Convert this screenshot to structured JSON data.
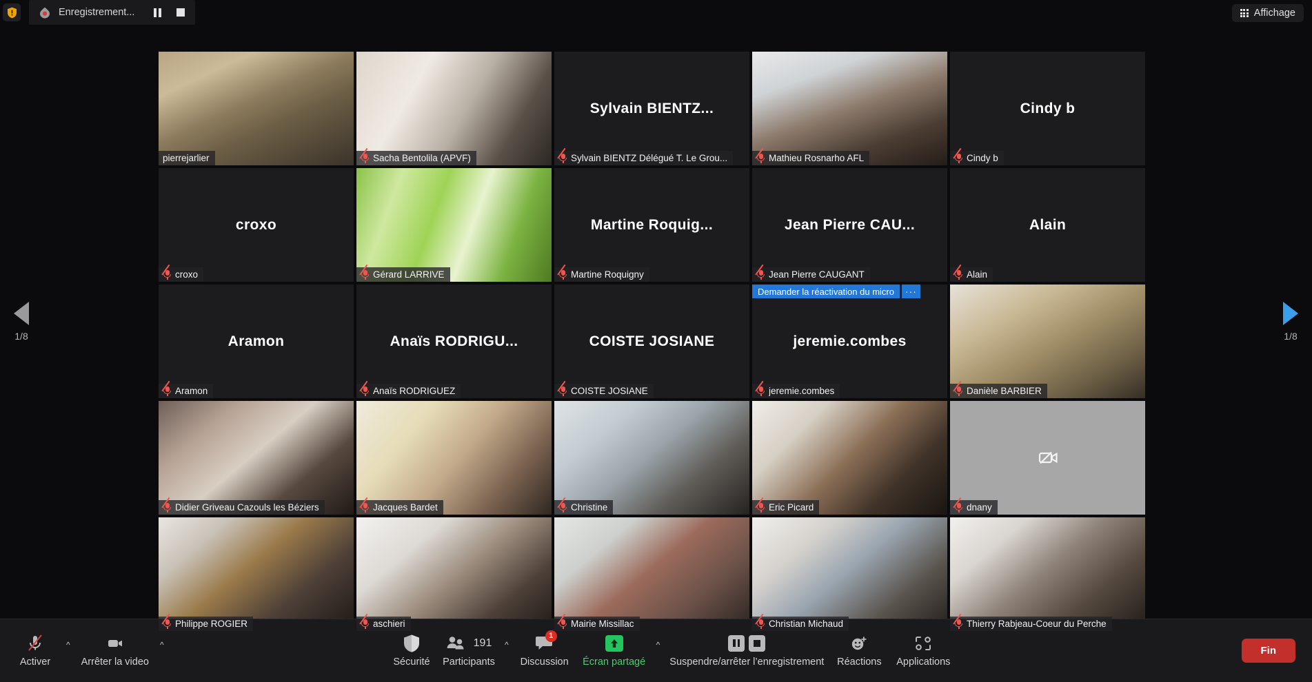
{
  "topbar": {
    "shield_icon": "security-shield-icon",
    "recording_icon": "recording-dot-icon",
    "recording_label": "Enregistrement...",
    "pause_recording_icon": "pause-icon",
    "stop_recording_icon": "stop-icon",
    "view_button_label": "Affichage",
    "view_button_icon": "grid-view-icon"
  },
  "gallery": {
    "prev_page_icon": "chevron-left-icon",
    "next_page_icon": "chevron-right-icon",
    "prev_page_indicator": "1/8",
    "next_page_indicator": "1/8",
    "muted_icon": "microphone-muted-icon",
    "no_video_icon": "camera-off-icon",
    "hover_controls": {
      "request_unmute_label": "Demander la réactivation du micro",
      "more_label": "···"
    },
    "tiles": [
      {
        "name": "pierrejarlier",
        "display": "",
        "video": true,
        "muted": false,
        "active": true,
        "bg": "bookshelf"
      },
      {
        "name": "Sacha Bentolila (APVF)",
        "display": "",
        "video": true,
        "muted": true,
        "active": false,
        "bg": "whiteroom"
      },
      {
        "name": "Sylvain BIENTZ Délégué T. Le Grou...",
        "display": "Sylvain  BIENTZ...",
        "video": false,
        "muted": true,
        "active": false,
        "bg": ""
      },
      {
        "name": "Mathieu Rosnarho AFL",
        "display": "",
        "video": true,
        "muted": true,
        "active": false,
        "bg": "manwindow"
      },
      {
        "name": "Cindy b",
        "display": "Cindy b",
        "video": false,
        "muted": true,
        "active": false,
        "bg": ""
      },
      {
        "name": "croxo",
        "display": "croxo",
        "video": false,
        "muted": true,
        "active": false,
        "bg": ""
      },
      {
        "name": "Gérard LARRIVE",
        "display": "",
        "video": true,
        "muted": true,
        "active": false,
        "bg": "grass"
      },
      {
        "name": "Martine Roquigny",
        "display": "Martine  Roquig...",
        "video": false,
        "muted": true,
        "active": false,
        "bg": ""
      },
      {
        "name": "Jean Pierre CAUGANT",
        "display": "Jean Pierre CAU...",
        "video": false,
        "muted": true,
        "active": false,
        "bg": ""
      },
      {
        "name": "Alain",
        "display": "Alain",
        "video": false,
        "muted": true,
        "active": false,
        "bg": ""
      },
      {
        "name": "Aramon",
        "display": "Aramon",
        "video": false,
        "muted": true,
        "active": false,
        "bg": ""
      },
      {
        "name": "Anaïs RODRIGUEZ",
        "display": "Anaïs  RODRIGU...",
        "video": false,
        "muted": true,
        "active": false,
        "bg": ""
      },
      {
        "name": "COISTE JOSIANE",
        "display": "COISTE JOSIANE",
        "video": false,
        "muted": true,
        "active": false,
        "bg": ""
      },
      {
        "name": "jeremie.combes",
        "display": "jeremie.combes",
        "video": false,
        "muted": true,
        "active": false,
        "bg": "",
        "hovered": true
      },
      {
        "name": "Danièle BARBIER",
        "display": "",
        "video": true,
        "muted": true,
        "active": false,
        "bg": "shelves"
      },
      {
        "name": "Didier Griveau Cazouls les Béziers",
        "display": "",
        "video": true,
        "muted": true,
        "active": false,
        "bg": "headsetman"
      },
      {
        "name": "Jacques Bardet",
        "display": "",
        "video": true,
        "muted": true,
        "active": false,
        "bg": "yellowroom"
      },
      {
        "name": "Christine",
        "display": "",
        "video": true,
        "muted": true,
        "active": false,
        "bg": "shutterroom"
      },
      {
        "name": "Eric Picard",
        "display": "",
        "video": true,
        "muted": true,
        "active": false,
        "bg": "meetingroom"
      },
      {
        "name": "dnany",
        "display": "",
        "video": false,
        "muted": true,
        "active": false,
        "bg": "novideo"
      },
      {
        "name": "Philippe ROGIER",
        "display": "",
        "video": true,
        "muted": true,
        "active": false,
        "bg": "manoffice"
      },
      {
        "name": "aschieri",
        "display": "",
        "video": true,
        "muted": true,
        "active": false,
        "bg": "manwhite"
      },
      {
        "name": "Mairie Missillac",
        "display": "",
        "video": true,
        "muted": true,
        "active": false,
        "bg": "hallroom"
      },
      {
        "name": "Christian Michaud",
        "display": "",
        "video": true,
        "muted": true,
        "active": false,
        "bg": "elderman"
      },
      {
        "name": "Thierry Rabjeau-Coeur du Perche",
        "display": "",
        "video": true,
        "muted": true,
        "active": false,
        "bg": "beardman"
      }
    ]
  },
  "toolbar": {
    "mic": {
      "label": "Activer",
      "icon": "microphone-muted-icon",
      "caret": "chevron-up-icon"
    },
    "video": {
      "label": "Arrêter la video",
      "icon": "camera-icon",
      "caret": "chevron-up-icon"
    },
    "security": {
      "label": "Sécurité",
      "icon": "shield-icon"
    },
    "participants": {
      "label": "Participants",
      "icon": "people-icon",
      "count": "191",
      "caret": "chevron-up-icon"
    },
    "chat": {
      "label": "Discussion",
      "icon": "chat-bubble-icon",
      "badge": "1"
    },
    "share": {
      "label": "Écran partagé",
      "icon": "share-screen-up-arrow-icon",
      "caret": "chevron-up-icon"
    },
    "record": {
      "label": "Suspendre/arrêter l’enregistrement",
      "pause_icon": "pause-icon",
      "stop_icon": "stop-icon"
    },
    "reactions": {
      "label": "Réactions",
      "icon": "smiley-plus-icon"
    },
    "apps": {
      "label": "Applications",
      "icon": "apps-icon"
    },
    "end": {
      "label": "Fin"
    }
  },
  "colors": {
    "accent_blue": "#2178d6",
    "active_border": "#e9ec3a",
    "mute_red": "#f2554d",
    "end_red": "#c3302b",
    "share_green": "#22c55e",
    "badge_red": "#e02b20"
  }
}
